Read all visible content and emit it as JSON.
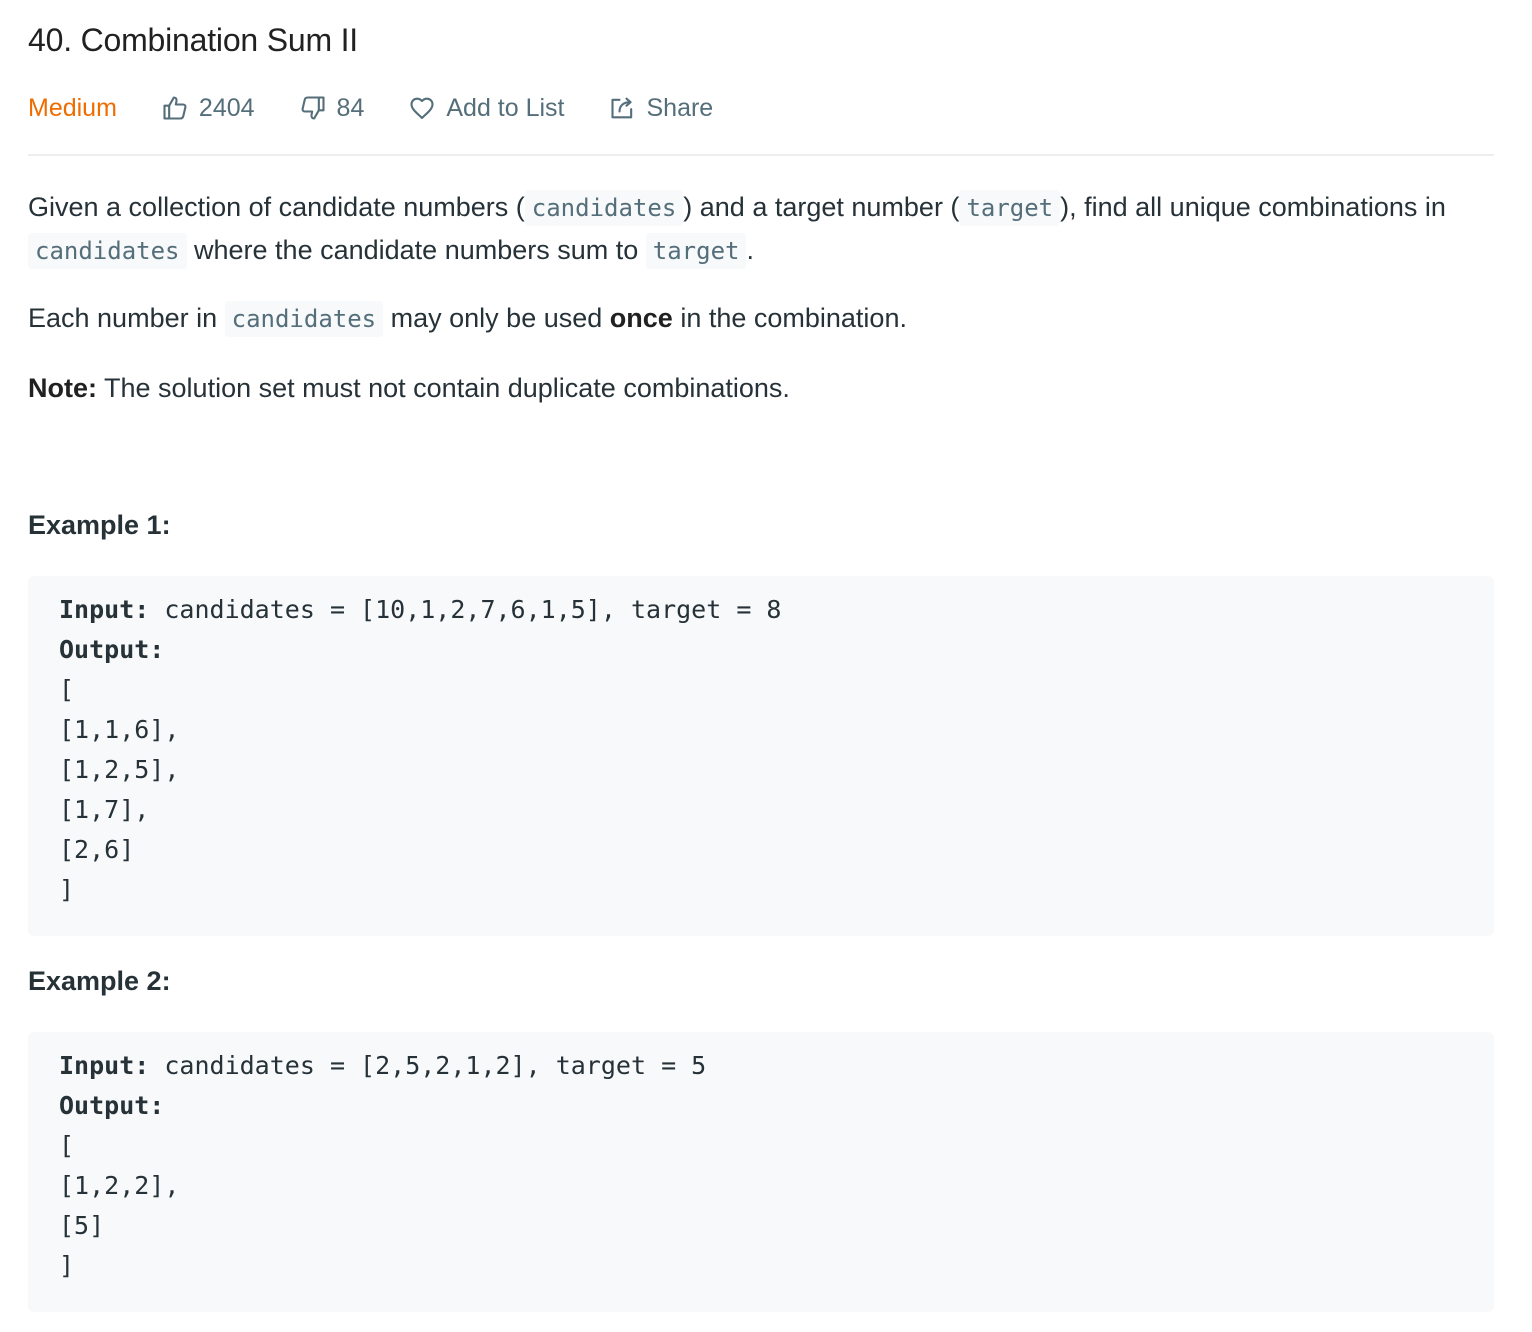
{
  "problem": {
    "title": "40. Combination Sum II",
    "difficulty": "Medium",
    "likes": "2404",
    "dislikes": "84",
    "add_to_list_label": "Add to List",
    "share_label": "Share"
  },
  "colors": {
    "difficulty": "#ef6c00",
    "meta_text": "#546e7a",
    "code_background": "#f7f9fa"
  },
  "description": {
    "p1": {
      "t1": "Given a collection of candidate numbers (",
      "c1": "candidates",
      "t2": ") and a target number (",
      "c2": "target",
      "t3": "), find all unique combinations in",
      "c3": "candidates",
      "t4": "where the candidate numbers sum to",
      "c4": "target",
      "t5": "."
    },
    "p2": {
      "t1": "Each number in",
      "c1": "candidates",
      "t2": "may only be used",
      "bold": "once",
      "t3": "in the combination."
    },
    "p3": {
      "bold": "Note:",
      "t1": "The solution set must not contain duplicate combinations."
    }
  },
  "examples": [
    {
      "title": "Example 1:",
      "input_label": "Input:",
      "input_value": "candidates = [10,1,2,7,6,1,5], target = 8",
      "output_label": "Output:",
      "output_lines": [
        "[",
        "[1,1,6],",
        "[1,2,5],",
        "[1,7],",
        "[2,6]",
        "]"
      ]
    },
    {
      "title": "Example 2:",
      "input_label": "Input:",
      "input_value": "candidates = [2,5,2,1,2], target = 5",
      "output_label": "Output:",
      "output_lines": [
        "[",
        "[1,2,2],",
        "[5]",
        "]"
      ]
    }
  ]
}
